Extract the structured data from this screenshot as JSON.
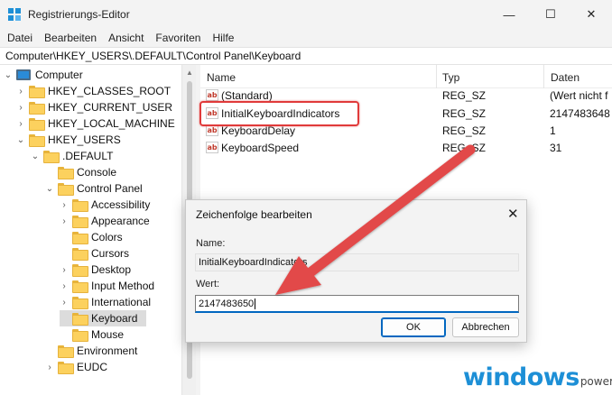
{
  "window": {
    "title": "Registrierungs-Editor",
    "controls": {
      "minimize": "—",
      "maximize": "☐",
      "close": "✕"
    }
  },
  "menu": [
    "Datei",
    "Bearbeiten",
    "Ansicht",
    "Favoriten",
    "Hilfe"
  ],
  "address": "Computer\\HKEY_USERS\\.DEFAULT\\Control Panel\\Keyboard",
  "tree": [
    {
      "label": "Computer",
      "expander": "⌄",
      "icon": "computer-icon"
    },
    {
      "label": "HKEY_CLASSES_ROOT",
      "expander": "›",
      "icon": "folder-icon"
    },
    {
      "label": "HKEY_CURRENT_USER",
      "expander": "›",
      "icon": "folder-icon"
    },
    {
      "label": "HKEY_LOCAL_MACHINE",
      "expander": "›",
      "icon": "folder-icon"
    },
    {
      "label": "HKEY_USERS",
      "expander": "⌄",
      "icon": "folder-icon"
    },
    {
      "label": ".DEFAULT",
      "expander": "⌄",
      "icon": "folder-icon"
    },
    {
      "label": "Console",
      "expander": "",
      "icon": "folder-icon"
    },
    {
      "label": "Control Panel",
      "expander": "⌄",
      "icon": "folder-icon"
    },
    {
      "label": "Accessibility",
      "expander": "›",
      "icon": "folder-icon"
    },
    {
      "label": "Appearance",
      "expander": "›",
      "icon": "folder-icon"
    },
    {
      "label": "Colors",
      "expander": "",
      "icon": "folder-icon"
    },
    {
      "label": "Cursors",
      "expander": "",
      "icon": "folder-icon"
    },
    {
      "label": "Desktop",
      "expander": "›",
      "icon": "folder-icon"
    },
    {
      "label": "Input Method",
      "expander": "›",
      "icon": "folder-icon"
    },
    {
      "label": "International",
      "expander": "›",
      "icon": "folder-icon"
    },
    {
      "label": "Keyboard",
      "expander": "",
      "icon": "folder-icon",
      "selected": true
    },
    {
      "label": "Mouse",
      "expander": "",
      "icon": "folder-icon"
    },
    {
      "label": "Environment",
      "expander": "",
      "icon": "folder-icon"
    },
    {
      "label": "EUDC",
      "expander": "›",
      "icon": "folder-icon"
    }
  ],
  "list": {
    "columns": [
      "Name",
      "Typ",
      "Daten"
    ],
    "rows": [
      {
        "name": "(Standard)",
        "type": "REG_SZ",
        "data": "(Wert nicht f",
        "icon": "ab"
      },
      {
        "name": "InitialKeyboardIndicators",
        "type": "REG_SZ",
        "data": "2147483648",
        "icon": "ab"
      },
      {
        "name": "KeyboardDelay",
        "type": "REG_SZ",
        "data": "1",
        "icon": "ab"
      },
      {
        "name": "KeyboardSpeed",
        "type": "REG_SZ",
        "data": "31",
        "icon": "ab"
      }
    ]
  },
  "dialog": {
    "title": "Zeichenfolge bearbeiten",
    "close": "✕",
    "name_label": "Name:",
    "name_value": "InitialKeyboardIndicators",
    "value_label": "Wert:",
    "value_value": "2147483650",
    "ok": "OK",
    "cancel": "Abbrechen"
  },
  "annotation": {
    "color": "#e03a3a"
  },
  "watermark": {
    "main": "windows",
    "sub": "power"
  },
  "colors": {
    "accent": "#0067c0",
    "folder": "#fcd15e",
    "selection": "#dcdcdc"
  }
}
